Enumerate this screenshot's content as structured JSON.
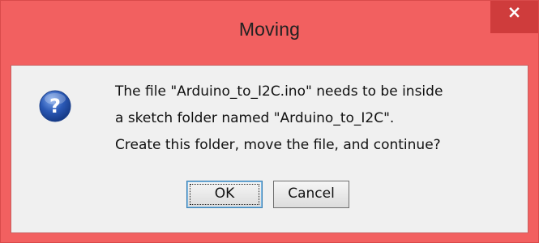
{
  "dialog": {
    "title": "Moving",
    "close_label": "×",
    "icon": "question-icon",
    "message_lines": [
      "The file \"Arduino_to_I2C.ino\" needs to be inside",
      "a sketch folder named \"Arduino_to_I2C\".",
      "Create this folder, move the file, and continue?"
    ],
    "buttons": {
      "ok_label": "OK",
      "cancel_label": "Cancel"
    },
    "colors": {
      "titlebar": "#f26060",
      "close_button": "#cf3c3c",
      "client_background": "#f0f0f0",
      "icon_blue": "#2a58b5"
    }
  }
}
